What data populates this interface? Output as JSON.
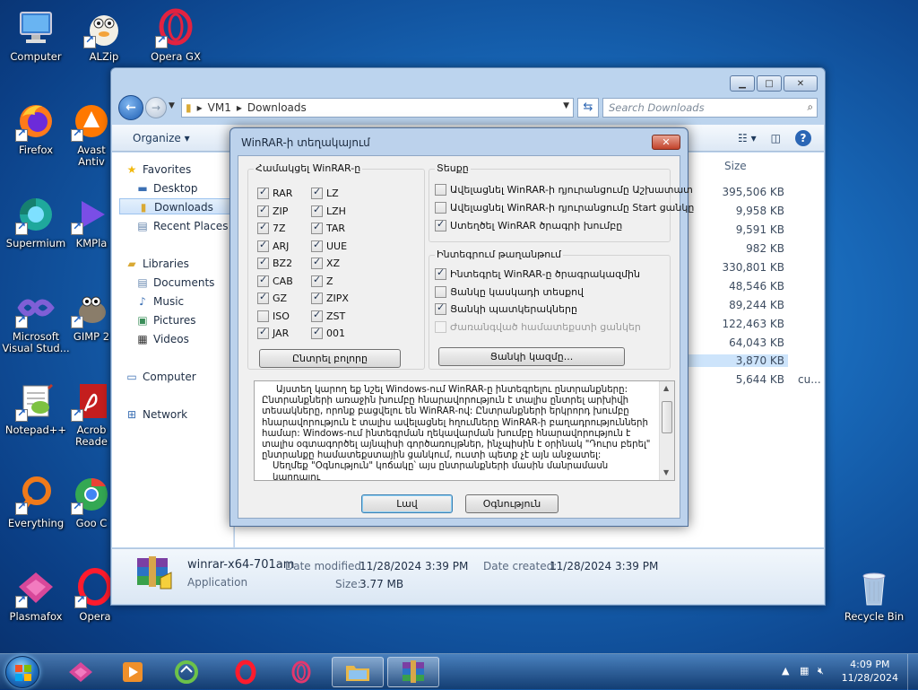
{
  "desktop": {
    "icons": [
      {
        "label": "Computer"
      },
      {
        "label": "ALZip"
      },
      {
        "label": "Opera GX"
      },
      {
        "label": "Firefox"
      },
      {
        "label": "Avast\nAntiv"
      },
      {
        "label": "Supermium"
      },
      {
        "label": "KMPla"
      },
      {
        "label": "Microsoft\nVisual Stud..."
      },
      {
        "label": "GIMP 2"
      },
      {
        "label": "Notepad++"
      },
      {
        "label": "Acrob\nReade"
      },
      {
        "label": "Everything"
      },
      {
        "label": "Goo C"
      },
      {
        "label": "Plasmafox"
      },
      {
        "label": "Opera"
      },
      {
        "label": "Recycle Bin"
      }
    ]
  },
  "explorer": {
    "window_buttons": {
      "minimize": "▁",
      "maximize": "□",
      "close": "✕"
    },
    "breadcrumb": [
      "VM1",
      "Downloads"
    ],
    "search_placeholder": "Search Downloads",
    "organize_label": "Organize ▾",
    "nav": {
      "favorites": "Favorites",
      "desktop": "Desktop",
      "downloads": "Downloads",
      "recent_places": "Recent Places",
      "libraries": "Libraries",
      "documents": "Documents",
      "music": "Music",
      "pictures": "Pictures",
      "videos": "Videos",
      "computer": "Computer",
      "network": "Network"
    },
    "column_size": "Size",
    "sizes": [
      "395,506 KB",
      "9,958 KB",
      "9,591 KB",
      "982 KB",
      "330,801 KB",
      "48,546 KB",
      "89,244 KB",
      "122,463 KB",
      "64,043 KB",
      "3,870 KB",
      "5,644 KB"
    ],
    "name_fragment": "cu...",
    "details": {
      "name": "winrar-x64-701am",
      "type": "Application",
      "date_modified_label": "Date modified:",
      "date_modified": "11/28/2024 3:39 PM",
      "date_created_label": "Date created:",
      "date_created": "11/28/2024 3:39 PM",
      "size_label": "Size:",
      "size": "3.77 MB"
    }
  },
  "dialog": {
    "title": "WinRAR-ի տեղակայում",
    "close_label": "✕",
    "associate_group": "Համակցել WinRAR-ը",
    "formats_col1": [
      {
        "label": "RAR",
        "checked": true
      },
      {
        "label": "ZIP",
        "checked": true
      },
      {
        "label": "7Z",
        "checked": true
      },
      {
        "label": "ARJ",
        "checked": true
      },
      {
        "label": "BZ2",
        "checked": true
      },
      {
        "label": "CAB",
        "checked": true
      },
      {
        "label": "GZ",
        "checked": true
      },
      {
        "label": "ISO",
        "checked": false
      },
      {
        "label": "JAR",
        "checked": true
      }
    ],
    "formats_col2": [
      {
        "label": "LZ",
        "checked": true
      },
      {
        "label": "LZH",
        "checked": true
      },
      {
        "label": "TAR",
        "checked": true
      },
      {
        "label": "UUE",
        "checked": true
      },
      {
        "label": "XZ",
        "checked": true
      },
      {
        "label": "Z",
        "checked": true
      },
      {
        "label": "ZIPX",
        "checked": true
      },
      {
        "label": "ZST",
        "checked": true
      },
      {
        "label": "001",
        "checked": true
      }
    ],
    "select_all_label": "Ընտրել բոլորը",
    "interface_group": "Տեսքը",
    "interface_items": [
      {
        "label": "Ավելացնել WinRAR-ի դյուրանցումը Աշխատատ",
        "checked": false
      },
      {
        "label": "Ավելացնել WinRAR-ի դյուրանցումը Start ցանկը",
        "checked": false
      },
      {
        "label": "Ստեղծել WinRAR ծրագրի խումբը",
        "checked": true
      }
    ],
    "shell_group": "Ինտեգրում թաղանթում",
    "shell_items": [
      {
        "label": "Ինտեգրել WinRAR-ը ծրագրակազմին",
        "checked": true,
        "disabled": false
      },
      {
        "label": "Ցանկը կասկադի տեսքով",
        "checked": false,
        "disabled": false
      },
      {
        "label": "Ցանկի պատկերակները",
        "checked": true,
        "disabled": false
      },
      {
        "label": "Ժառանգված համատեքստի ցանկեր",
        "checked": false,
        "disabled": true
      }
    ],
    "context_menu_button": "Ցանկի կազմը...",
    "description": [
      "Այստեղ կարող եք նշել Windows-ում WinRAR-ը ինտեգրելու ընտրանքները:",
      "Ընտրանքների առաջին խումբը հնարավորություն է տալիս ընտրել արխիվի տեսակները, որոնք բացվելու են WinRAR-ով: Ընտրանքների երկրորդ խումբը հնարավորություն է տալիս ավելացնել հղումները WinRAR-ի բաղադրությունների համար: Windows-ում ինտեգրման ղեկավարման խումբը հնարավորություն է տալիս օգտագործել այնպիսի գործառույթներ, ինչպիսին է օրինակ \"Դուրս բերել\" ընտրանքը համատեքստային ցանկում, ուստի պետք չէ այն անջատել:",
      "Սեղմեք \"Օգնություն\" կոճակը՝ այս ընտրանքների մասին մանրամասն կարդալու"
    ],
    "ok_label": "Լավ",
    "help_label": "Օգնություն"
  },
  "taskbar": {
    "time": "4:09 PM",
    "date": "11/28/2024"
  }
}
